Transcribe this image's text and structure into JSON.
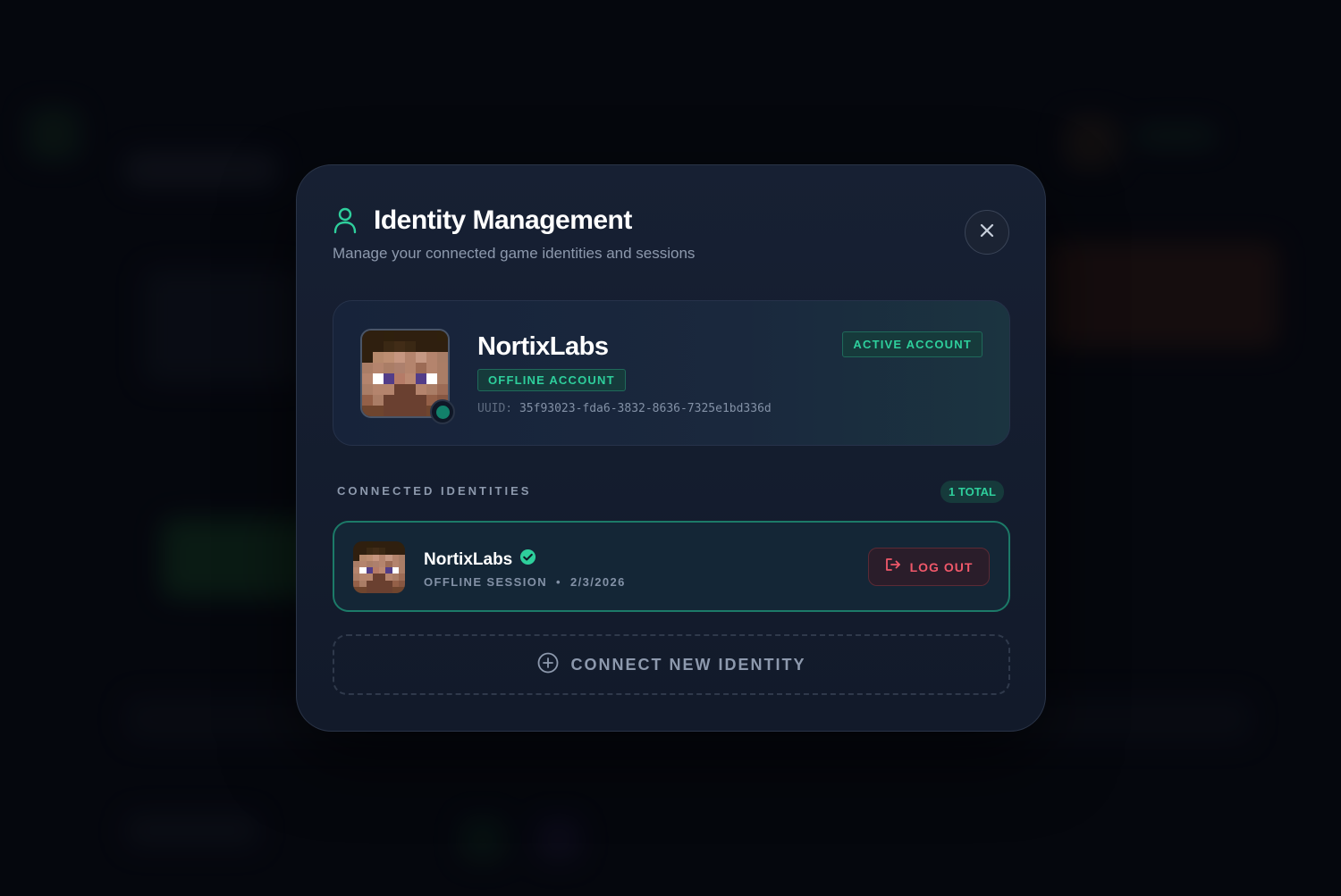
{
  "modal": {
    "title": "Identity Management",
    "subtitle": "Manage your connected game identities and sessions",
    "close_label": "Close"
  },
  "active_account": {
    "name": "NortixLabs",
    "type_badge": "OFFLINE ACCOUNT",
    "status_badge": "ACTIVE ACCOUNT",
    "uuid_label": "UUID:",
    "uuid": "35f93023-fda6-3832-8636-7325e1bd336d"
  },
  "connected": {
    "section_label": "CONNECTED IDENTITIES",
    "total": "1 TOTAL",
    "items": [
      {
        "name": "NortixLabs",
        "session": "OFFLINE SESSION",
        "separator": "•",
        "date": "2/3/2026",
        "logout_label": "LOG OUT"
      }
    ]
  },
  "connect_new": {
    "label": "CONNECT NEW IDENTITY"
  },
  "colors": {
    "accent": "#2ecf9c",
    "danger": "#f0586a",
    "modal_bg": "#172033"
  },
  "icons": {
    "header": "user-icon",
    "close": "close-icon",
    "verified": "verified-check-icon",
    "logout": "logout-icon",
    "add": "plus-circle-icon"
  }
}
